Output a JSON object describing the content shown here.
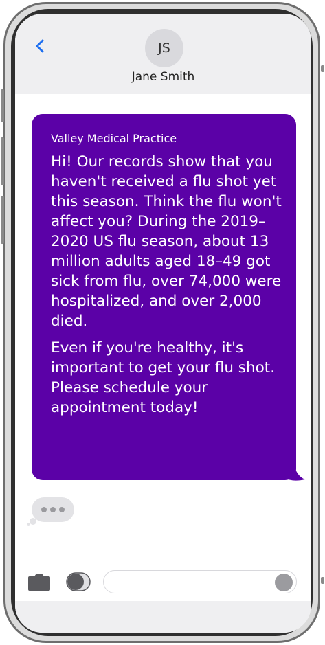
{
  "contact": {
    "initials": "JS",
    "name": "Jane Smith"
  },
  "message": {
    "sender": "Valley Medical Practice",
    "paragraphs": [
      "Hi! Our records show that you haven't received a flu shot yet this season. Think the flu won't affect you? During the 2019–2020 US flu season, about 13 million adults aged 18–49 got sick from flu, over 74,000 were hospitalized, and over 2,000 died.",
      "Even if you're healthy, it's important to get your flu shot. Please schedule your appointment today!"
    ]
  },
  "icons": {
    "back": "chevron-left-icon",
    "camera": "camera-icon",
    "apps": "apps-toggle-icon",
    "send": "send-icon"
  },
  "colors": {
    "bubble": "#5b01a7",
    "accent": "#1e6ff0",
    "header_bg": "#efeff1"
  }
}
